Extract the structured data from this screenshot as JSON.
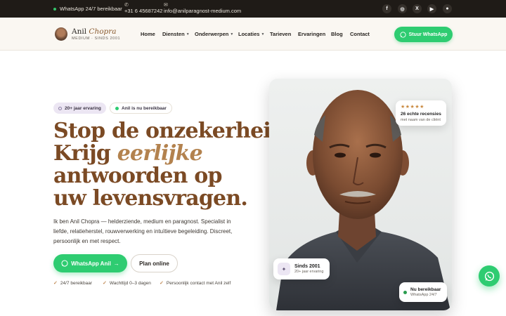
{
  "topbar": {
    "availability": "WhatsApp 24/7 bereikbaar",
    "phone": "+31 6 45687242",
    "email": "info@anilparagnost-medium.com",
    "socials": [
      "facebook-icon",
      "instagram-icon",
      "x-icon",
      "youtube-icon",
      "reddit-icon"
    ]
  },
  "brand": {
    "first": "Anil",
    "last": "Chopra",
    "tagline": "MEDIUM · SINDS 2001"
  },
  "nav": {
    "items": [
      {
        "label": "Home",
        "dropdown": false
      },
      {
        "label": "Diensten",
        "dropdown": true
      },
      {
        "label": "Onderwerpen",
        "dropdown": true
      },
      {
        "label": "Locaties",
        "dropdown": true
      },
      {
        "label": "Tarieven",
        "dropdown": false
      },
      {
        "label": "Ervaringen",
        "dropdown": false
      },
      {
        "label": "Blog",
        "dropdown": false
      },
      {
        "label": "Contact",
        "dropdown": false
      }
    ],
    "cta": "Stuur WhatsApp"
  },
  "hero": {
    "badge_experience": "20+ jaar ervaring",
    "badge_available": "Anil is nu bereikbaar",
    "headline_1": "Stop de onzekerheid.",
    "headline_2a": "Krijg ",
    "headline_2b": "eerlijke",
    "headline_3": "antwoorden op",
    "headline_4": "uw levensvragen.",
    "intro": "Ik ben Anil Chopra — helderziende, medium en paragnost. Specialist in liefde, relatieherstel, rouwverwerking en intuïtieve begeleiding. Discreet, persoonlijk en met respect.",
    "cta_primary": "WhatsApp Anil",
    "cta_arrow": "→",
    "cta_secondary": "Plan online",
    "checks": [
      "24/7 bereikbaar",
      "Wachttijd 0–3 dagen",
      "Persoonlijk contact met Anil zelf"
    ]
  },
  "cards": {
    "stars": "★★★★★",
    "reviews_title": "26 echte recensies",
    "reviews_sub": "met naam van de cliënt",
    "since_icon": "sparkle-icon",
    "since_title": "Sinds 2001",
    "since_sub": "20+ jaar ervaring",
    "now_title": "Nu bereikbaar",
    "now_sub": "WhatsApp 24/7"
  },
  "colors": {
    "accent_green": "#2ecc71",
    "headline_brown": "#7b4a24",
    "topbar_bg": "#1f1b17",
    "header_bg": "#faf7f2"
  }
}
